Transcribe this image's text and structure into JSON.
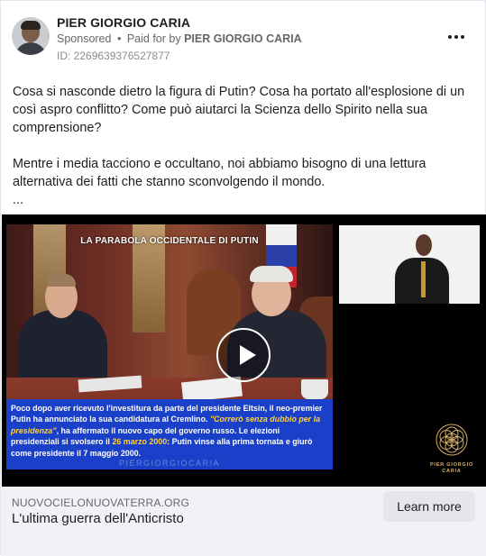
{
  "advertiser": {
    "name": "PIER GIORGIO CARIA",
    "sponsored_label": "Sponsored",
    "separator": "•",
    "paid_for_prefix": "Paid for by",
    "paid_for_name": "PIER GIORGIO CARIA",
    "ad_id": "ID: 2269639376527877"
  },
  "post": {
    "paragraph_1": "Cosa si nasconde dietro la figura di Putin? Cosa ha portato all'esplosione di un così aspro conflitto? Come può aiutarci la Scienza dello Spirito nella sua comprensione?",
    "paragraph_2": "Mentre i media tacciono e occultano, noi abbiamo bisogno di una lettura alternativa dei fatti che stanno sconvolgendo il mondo.",
    "ellipsis": "..."
  },
  "video": {
    "title": "LA PARABOLA OCCIDENTALE DI PUTIN",
    "caption_1": "Poco dopo aver ricevuto l'investitura da parte del presidente Eltsin, il neo-premier Putin ha annunciato la sua candidatura al Cremlino. ",
    "caption_quote": "\"Correrò senza dubbio per la presidenza\"",
    "caption_2": ", ha affermato il nuovo capo del governo russo. Le elezioni presidenziali si svolsero il ",
    "caption_date": "26 marzo 2000",
    "caption_3": ": Putin vinse alla prima tornata e giurò come presidente il 7 maggio 2000.",
    "watermark": "PIERGIORGIOCARIA",
    "logo_line_1": "PIER GIORGIO",
    "logo_line_2": "CARIA"
  },
  "link": {
    "domain": "NUOVOCIELONUOVATERRA.ORG",
    "headline": "L'ultima guerra dell'Anticristo",
    "cta_label": "Learn more"
  },
  "icons": {
    "more": "more-options-icon",
    "play": "play-icon",
    "logo": "flower-of-life-logo"
  },
  "colors": {
    "caption_bg": "#1a3fc8",
    "highlight": "#ffd23a",
    "footer_bg": "#f0f2f5",
    "button_bg": "#e4e6eb"
  }
}
